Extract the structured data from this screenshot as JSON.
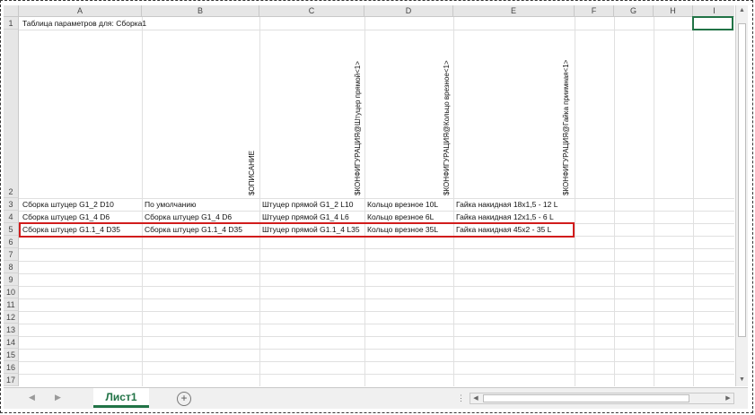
{
  "columns": [
    "A",
    "B",
    "C",
    "D",
    "E",
    "F",
    "G",
    "H",
    "I"
  ],
  "rows": [
    "1",
    "2",
    "3",
    "4",
    "5",
    "6",
    "7",
    "8",
    "9",
    "10",
    "11",
    "12",
    "13",
    "14",
    "15",
    "16",
    "17"
  ],
  "cells": {
    "a1": "Таблица параметров для: Сборка1",
    "b2": "$ОПИСАНИЕ",
    "c2": "$КОНФИГУРАЦИЯ@Штуцер прямой<1>",
    "d2": "$КОНФИГУРАЦИЯ@Кольцо врезное<1>",
    "e2": "$КОНФИГУРАЦИЯ@Гайка приимная<1>"
  },
  "data_rows": [
    {
      "a": "Сборка штуцер G1_2 D10",
      "b": "По умолчанию",
      "c": "Штуцер прямой G1_2 L10",
      "d": "Кольцо врезное 10L",
      "e": "Гайка накидная 18x1,5 - 12 L"
    },
    {
      "a": "Сборка штуцер G1_4 D6",
      "b": "Сборка штуцер G1_4 D6",
      "c": "Штуцер прямой G1_4 L6",
      "d": "Кольцо врезное 6L",
      "e": "Гайка накидная 12x1,5 - 6 L"
    },
    {
      "a": "Сборка штуцер G1.1_4 D35",
      "b": "Сборка штуцер G1.1_4 D35",
      "c": "Штуцер прямой G1.1_4 L35",
      "d": "Кольцо врезное 35L",
      "e": "Гайка накидная 45x2 - 35 L"
    }
  ],
  "sheet_tab": "Лист1",
  "add_sheet": "+",
  "colors": {
    "highlight": "#d11c1c",
    "accent": "#217346"
  }
}
